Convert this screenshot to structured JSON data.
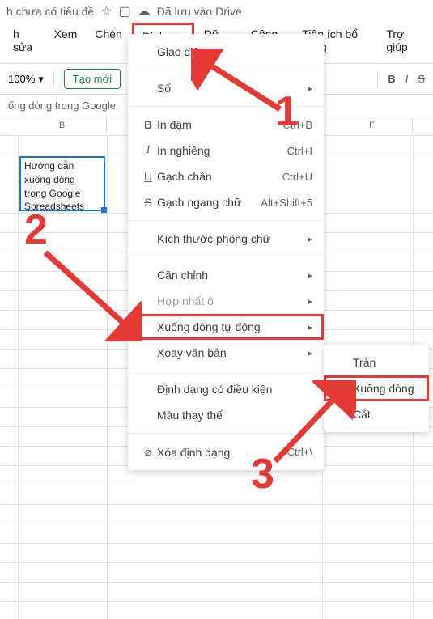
{
  "titlebar": {
    "title": "h chưa có tiêu đề",
    "save_status": "Đã lưu vào Drive"
  },
  "menubar": {
    "edit": "h sửa",
    "view": "Xem",
    "insert": "Chèn",
    "format": "Định dạng",
    "data": "Dữ liệu",
    "tools": "Công cụ",
    "addons": "Tiện ích bổ sung",
    "help": "Trợ giúp"
  },
  "toolbar": {
    "zoom": "100%",
    "create_new": "Tạo mới"
  },
  "fx_bar": "ống dòng trong Google",
  "columns": {
    "B": "B",
    "F": "F"
  },
  "cell": {
    "line1": "Hướng dẫn",
    "line2": "xuống dòng",
    "line3": "trong Google",
    "line4": "Spreadsheets"
  },
  "menu": {
    "theme": "Giao diện",
    "number": "Số",
    "bold": "In đậm",
    "bold_sc": "Ctrl+B",
    "italic": "In nghiêng",
    "italic_sc": "Ctrl+I",
    "underline": "Gạch chân",
    "underline_sc": "Ctrl+U",
    "strike": "Gạch ngang chữ",
    "strike_sc": "Alt+Shift+5",
    "fontsize": "Kích thước phông chữ",
    "align": "Căn chỉnh",
    "merge": "Hợp nhất ô",
    "wrap": "Xuống dòng tự động",
    "rotate": "Xoay văn bản",
    "cond": "Định dạng có điều kiện",
    "altcolor": "Màu thay thế",
    "clear": "Xóa định dạng",
    "clear_sc": "Ctrl+\\"
  },
  "submenu": {
    "overflow": "Tràn",
    "wrap": "Xuống dòng",
    "clip": "Cắt"
  },
  "annotations": {
    "n1": "1",
    "n2": "2",
    "n3": "3"
  }
}
